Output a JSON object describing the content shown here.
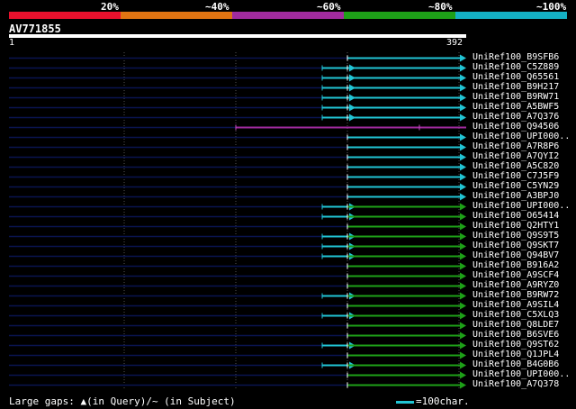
{
  "scale": {
    "labels": [
      "20%",
      "~40%",
      "~60%",
      "~80%",
      "~100%"
    ],
    "colors": [
      "#e8112d",
      "#e07412",
      "#a12b9e",
      "#1ea018",
      "#14b0c4"
    ]
  },
  "query": {
    "title": "AV771855",
    "start": "1",
    "end": "392"
  },
  "hits": [
    {
      "name": "UniRef100_B9SFB6",
      "color": "#21c4d4",
      "extend": false,
      "purple": false
    },
    {
      "name": "UniRef100_C5Z889",
      "color": "#21c4d4",
      "extend": true,
      "purple": false
    },
    {
      "name": "UniRef100_Q65561",
      "color": "#21c4d4",
      "extend": true,
      "purple": false
    },
    {
      "name": "UniRef100_B9H217",
      "color": "#21c4d4",
      "extend": true,
      "purple": false
    },
    {
      "name": "UniRef100_B9RW71",
      "color": "#21c4d4",
      "extend": true,
      "purple": false
    },
    {
      "name": "UniRef100_A5BWF5",
      "color": "#21c4d4",
      "extend": true,
      "purple": false
    },
    {
      "name": "UniRef100_A7Q376",
      "color": "#21c4d4",
      "extend": true,
      "purple": false
    },
    {
      "name": "UniRef100_Q94506",
      "color": "#21c4d4",
      "extend": false,
      "purple": true
    },
    {
      "name": "UniRef100_UPI000..",
      "color": "#21c4d4",
      "extend": false,
      "purple": false
    },
    {
      "name": "UniRef100_A7R8P6",
      "color": "#21c4d4",
      "extend": false,
      "purple": false
    },
    {
      "name": "UniRef100_A7QYI2",
      "color": "#21c4d4",
      "extend": false,
      "purple": false
    },
    {
      "name": "UniRef100_A5C820",
      "color": "#21c4d4",
      "extend": false,
      "purple": false
    },
    {
      "name": "UniRef100_C7J5F9",
      "color": "#21c4d4",
      "extend": false,
      "purple": false
    },
    {
      "name": "UniRef100_C5YN29",
      "color": "#21c4d4",
      "extend": false,
      "purple": false
    },
    {
      "name": "UniRef100_A3BPJ0",
      "color": "#21c4d4",
      "extend": false,
      "purple": false
    },
    {
      "name": "UniRef100_UPI000..",
      "color": "#1ea018",
      "extend": true,
      "purple": false
    },
    {
      "name": "UniRef100_O65414",
      "color": "#1ea018",
      "extend": true,
      "purple": false
    },
    {
      "name": "UniRef100_Q2HTY1",
      "color": "#1ea018",
      "extend": false,
      "purple": false
    },
    {
      "name": "UniRef100_Q9S9T5",
      "color": "#1ea018",
      "extend": true,
      "purple": false
    },
    {
      "name": "UniRef100_Q9SKT7",
      "color": "#1ea018",
      "extend": true,
      "purple": false
    },
    {
      "name": "UniRef100_Q94BV7",
      "color": "#1ea018",
      "extend": true,
      "purple": false
    },
    {
      "name": "UniRef100_B916A2",
      "color": "#1ea018",
      "extend": false,
      "purple": false
    },
    {
      "name": "UniRef100_A9SCF4",
      "color": "#1ea018",
      "extend": false,
      "purple": false
    },
    {
      "name": "UniRef100_A9RYZ0",
      "color": "#1ea018",
      "extend": false,
      "purple": false
    },
    {
      "name": "UniRef100_B9RW72",
      "color": "#1ea018",
      "extend": true,
      "purple": false
    },
    {
      "name": "UniRef100_A9SIL4",
      "color": "#1ea018",
      "extend": false,
      "purple": false
    },
    {
      "name": "UniRef100_C5XLQ3",
      "color": "#1ea018",
      "extend": true,
      "purple": false
    },
    {
      "name": "UniRef100_Q8LDE7",
      "color": "#1ea018",
      "extend": false,
      "purple": false
    },
    {
      "name": "UniRef100_B6SVE6",
      "color": "#1ea018",
      "extend": false,
      "purple": false
    },
    {
      "name": "UniRef100_Q9ST62",
      "color": "#1ea018",
      "extend": true,
      "purple": false
    },
    {
      "name": "UniRef100_Q1JPL4",
      "color": "#1ea018",
      "extend": false,
      "purple": false
    },
    {
      "name": "UniRef100_B4G0B6",
      "color": "#1ea018",
      "extend": true,
      "purple": false
    },
    {
      "name": "UniRef100_UPI000..",
      "color": "#1ea018",
      "extend": false,
      "purple": false
    },
    {
      "name": "UniRef100_A7Q378",
      "color": "#1ea018",
      "extend": false,
      "purple": false
    }
  ],
  "footer": {
    "gaps_text": "Large gaps: ▲(in Query)/~ (in Subject)",
    "legend_text": "=100char."
  }
}
